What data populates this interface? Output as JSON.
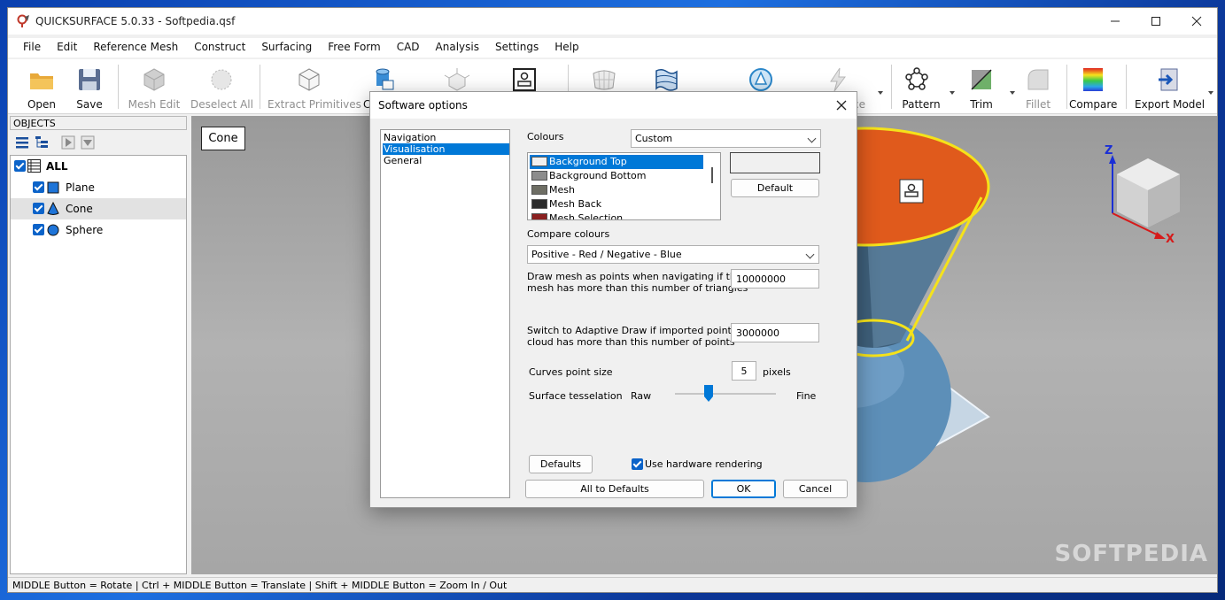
{
  "window": {
    "title": "QUICKSURFACE 5.0.33 - Softpedia.qsf"
  },
  "menu": [
    "File",
    "Edit",
    "Reference Mesh",
    "Construct",
    "Surfacing",
    "Free Form",
    "CAD",
    "Analysis",
    "Settings",
    "Help"
  ],
  "toolbar": {
    "open": "Open",
    "save": "Save",
    "mesh_edit": "Mesh Edit",
    "deselect_all": "Deselect All",
    "extract_primitives": "Extract Primitives",
    "construct_partial": "C",
    "freeform_partial": "ce",
    "pattern": "Pattern",
    "trim": "Trim",
    "fillet": "Fillet",
    "compare": "Compare",
    "export_model": "Export Model"
  },
  "objects": {
    "header": "OBJECTS",
    "items": [
      {
        "label": "ALL",
        "shape": "list-icon"
      },
      {
        "label": "Plane",
        "shape": "square-icon"
      },
      {
        "label": "Cone",
        "shape": "cone-icon"
      },
      {
        "label": "Sphere",
        "shape": "sphere-icon"
      }
    ]
  },
  "viewport": {
    "selected_label": "Cone",
    "axis_z": "Z",
    "axis_x": "X",
    "watermark": "SOFTPEDIA",
    "colors": {
      "cone_top": "#e05a1c",
      "cone_body": "#3e5f7a",
      "sphere": "#5d8fb8",
      "edge": "#f5e21a"
    }
  },
  "status": "MIDDLE Button = Rotate | Ctrl + MIDDLE Button = Translate | Shift + MIDDLE Button = Zoom In / Out",
  "dialog": {
    "title": "Software options",
    "nav": [
      "Navigation",
      "Visualisation",
      "General"
    ],
    "nav_selected": 1,
    "colours_label": "Colours",
    "colours_value": "Custom",
    "colour_items": [
      {
        "label": "Background Top",
        "color": "#f0f0f0"
      },
      {
        "label": "Background Bottom",
        "color": "#8c8c8c"
      },
      {
        "label": "Mesh",
        "color": "#6e6e64"
      },
      {
        "label": "Mesh Back",
        "color": "#2a2a2a"
      },
      {
        "label": "Mesh Selection",
        "color": "#8b2020"
      }
    ],
    "default_button": "Default",
    "compare_label": "Compare colours",
    "compare_value": "Positive - Red / Negative - Blue",
    "points_label_1": "Draw mesh as points when navigating if the",
    "points_label_2": "mesh has more than this number of triangles",
    "points_value": "10000000",
    "adaptive_label_1": "Switch to Adaptive Draw if imported point",
    "adaptive_label_2": "cloud has more than this number of points",
    "adaptive_value": "3000000",
    "curves_label": "Curves point size",
    "curves_value": "5",
    "curves_unit": "pixels",
    "tess_label": "Surface tesselation",
    "tess_raw": "Raw",
    "tess_fine": "Fine",
    "tess_level": 0.33,
    "defaults_button": "Defaults",
    "hw_label": "Use hardware rendering",
    "all_defaults_button": "All to Defaults",
    "ok_button": "OK",
    "cancel_button": "Cancel"
  }
}
